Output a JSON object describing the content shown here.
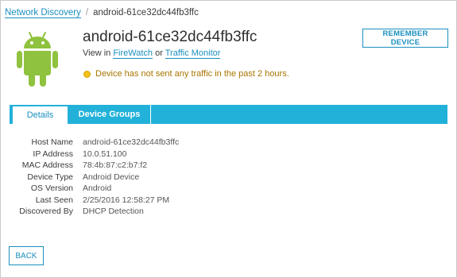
{
  "breadcrumb": {
    "root_label": "Network Discovery",
    "separator": "/",
    "current": "android-61ce32dc44fb3ffc"
  },
  "header": {
    "device_name": "android-61ce32dc44fb3ffc",
    "view_in_prefix": "View in",
    "link_firewatch": "FireWatch",
    "or_text": "or",
    "link_traffic_monitor": "Traffic Monitor",
    "warning_text": "Device has not sent any traffic in the past 2 hours.",
    "device_icon": "android-icon",
    "warning_icon": "yellow-dot-icon"
  },
  "actions": {
    "remember_label": "REMEMBER DEVICE",
    "back_label": "BACK"
  },
  "tabs": [
    {
      "label": "Details",
      "active": true
    },
    {
      "label": "Device Groups",
      "active": false
    }
  ],
  "details": [
    {
      "label": "Host Name",
      "value": "android-61ce32dc44fb3ffc"
    },
    {
      "label": "IP Address",
      "value": "10.0.51.100"
    },
    {
      "label": "MAC Address",
      "value": "78:4b:87:c2:b7:f2"
    },
    {
      "label": "Device Type",
      "value": "Android Device"
    },
    {
      "label": "OS Version",
      "value": "Android"
    },
    {
      "label": "Last Seen",
      "value": "2/25/2016 12:58:27 PM"
    },
    {
      "label": "Discovered By",
      "value": "DHCP Detection"
    }
  ],
  "colors": {
    "accent": "#1a8fbf",
    "tab_bar": "#22b1d9",
    "android_green": "#8fc23e",
    "warning_text": "#a87400",
    "warning_dot": "#f3c21b"
  }
}
